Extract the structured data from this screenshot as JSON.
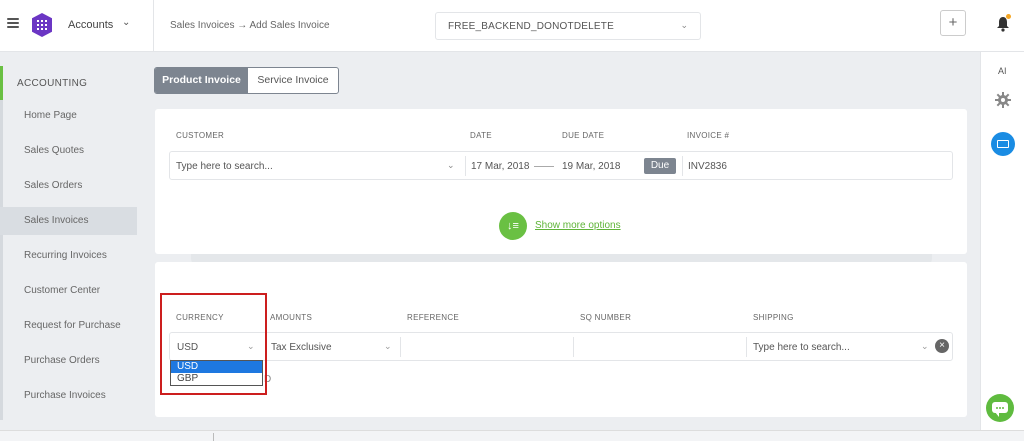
{
  "app": {
    "name": "Accounts"
  },
  "breadcrumb": "Sales Invoices → Add Sales Invoice",
  "company": {
    "selected": "FREE_BACKEND_DONOTDELETE"
  },
  "header_actions": {
    "plus": "+"
  },
  "sidebar": {
    "section": "ACCOUNTING",
    "items": [
      {
        "label": "Home Page"
      },
      {
        "label": "Sales Quotes"
      },
      {
        "label": "Sales Orders"
      },
      {
        "label": "Sales Invoices",
        "active": true
      },
      {
        "label": "Recurring Invoices"
      },
      {
        "label": "Customer Center"
      },
      {
        "label": "Request for Purchase"
      },
      {
        "label": "Purchase Orders"
      },
      {
        "label": "Purchase Invoices"
      }
    ]
  },
  "right_rail": {
    "ai": "AI"
  },
  "invoice_tabs": {
    "product": "Product Invoice",
    "service": "Service Invoice",
    "active": "product"
  },
  "customer_section": {
    "labels": {
      "customer": "CUSTOMER",
      "date": "DATE",
      "due_date": "DUE DATE",
      "invoice_no": "INVOICE #"
    },
    "customer_placeholder": "Type here to search...",
    "date": "17 Mar, 2018",
    "due_date": "19 Mar, 2018",
    "due_badge": "Due",
    "invoice_no": "INV2836",
    "more_options": "Show more options"
  },
  "currency_section": {
    "labels": {
      "currency": "CURRENCY",
      "amounts": "AMOUNTS",
      "reference": "REFERENCE",
      "sq_number": "SQ NUMBER",
      "shipping": "SHIPPING"
    },
    "currency": "USD",
    "amounts": "Tax Exclusive",
    "reference": "",
    "sq_number": "",
    "shipping_placeholder": "Type here to search...",
    "currency_options": [
      "USD",
      "GBP"
    ],
    "behind_dropdown_char": "D"
  },
  "colors": {
    "accent_green": "#6ac043",
    "brand_purple": "#6b36c4",
    "highlight_red": "#cc1e1e",
    "selected_blue": "#1e78e0"
  }
}
